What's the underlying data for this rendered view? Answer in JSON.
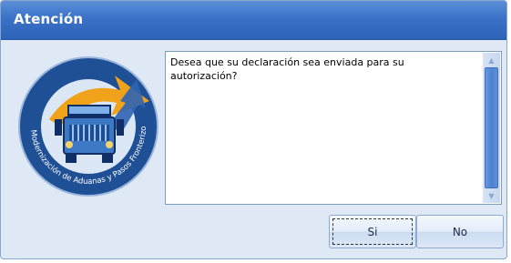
{
  "window": {
    "title": "Atención"
  },
  "logo": {
    "ring_text": "Modernización de Aduanas y Pasos Fronterizos",
    "colors": {
      "ring": "#1f4f94",
      "arrow": "#f0a21a",
      "truck": "#3d78c5"
    }
  },
  "message": {
    "text": "Desea que su declaración sea enviada para su\nautorización?"
  },
  "buttons": {
    "yes_label": "Si",
    "no_label": "No"
  },
  "colors": {
    "titlebar": "#3b72c7",
    "dialog_bg": "#dfe8f5",
    "scroll_thumb": "#4d82d2"
  }
}
